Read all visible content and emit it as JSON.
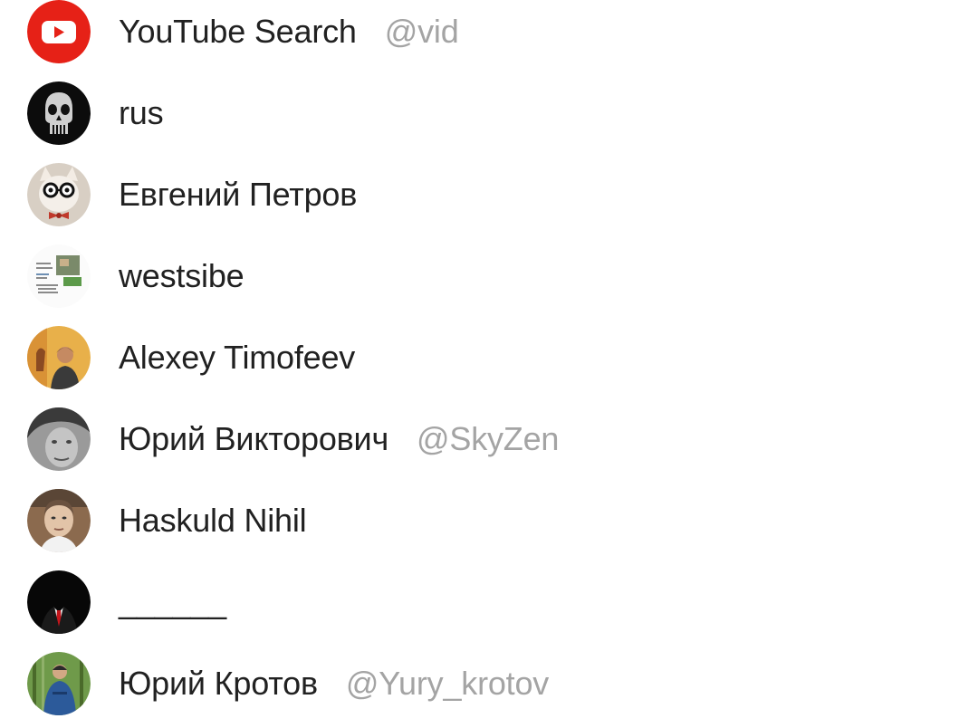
{
  "mention_list": {
    "items": [
      {
        "name": "YouTube Search",
        "username": "@vid",
        "avatar_icon": "youtube-logo-icon"
      },
      {
        "name": "rus",
        "username": "",
        "avatar_icon": "skull-avatar-icon"
      },
      {
        "name": "Евгений Петров",
        "username": "",
        "avatar_icon": "cat-with-glasses-avatar-icon"
      },
      {
        "name": "westsibe",
        "username": "",
        "avatar_icon": "document-avatar-icon"
      },
      {
        "name": "Alexey Timofeev",
        "username": "",
        "avatar_icon": "person-photo-avatar-icon"
      },
      {
        "name": "Юрий Викторович",
        "username": "@SkyZen",
        "avatar_icon": "grayscale-face-avatar-icon"
      },
      {
        "name": "Haskuld Nihil",
        "username": "",
        "avatar_icon": "person-photo-avatar-icon"
      },
      {
        "name": "______",
        "username": "",
        "avatar_icon": "suit-silhouette-avatar-icon"
      },
      {
        "name": "Юрий Кротов",
        "username": "@Yury_krotov",
        "avatar_icon": "forest-person-avatar-icon"
      }
    ]
  },
  "colors": {
    "name_text": "#212121",
    "username_text": "#a4a4a4",
    "youtube_red": "#e62117"
  }
}
